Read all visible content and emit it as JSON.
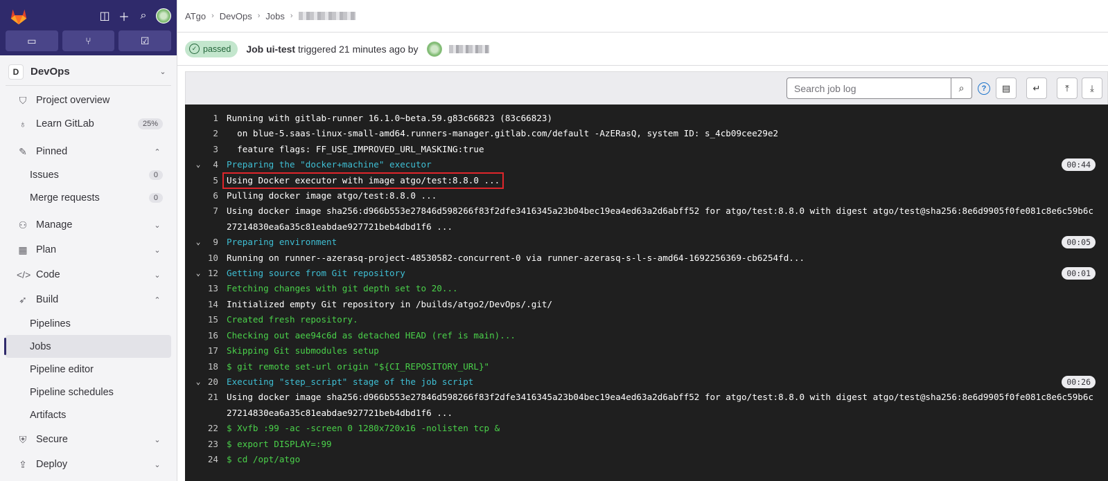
{
  "sidebar": {
    "project": {
      "avatar": "D",
      "name": "DevOps"
    },
    "items": [
      {
        "key": "overview",
        "label": "Project overview",
        "icon": "project-icon"
      },
      {
        "key": "learn",
        "label": "Learn GitLab",
        "icon": "bulb-icon",
        "badge": "25%"
      }
    ],
    "pinned": {
      "label": "Pinned",
      "items": [
        {
          "label": "Issues",
          "count": "0"
        },
        {
          "label": "Merge requests",
          "count": "0"
        }
      ]
    },
    "groups": [
      {
        "label": "Manage"
      },
      {
        "label": "Plan"
      },
      {
        "label": "Code"
      }
    ],
    "build": {
      "label": "Build",
      "items": [
        "Pipelines",
        "Jobs",
        "Pipeline editor",
        "Pipeline schedules",
        "Artifacts"
      ]
    },
    "after": [
      {
        "label": "Secure"
      },
      {
        "label": "Deploy"
      }
    ]
  },
  "breadcrumb": [
    "ATgo",
    "DevOps",
    "Jobs"
  ],
  "job": {
    "status": "passed",
    "title": "Job ui-test",
    "meta": "triggered 21 minutes ago by"
  },
  "toolbar": {
    "search_placeholder": "Search job log"
  },
  "log": [
    {
      "n": "1",
      "t": "Running with gitlab-runner 16.1.0~beta.59.g83c66823 (83c66823)",
      "c": ""
    },
    {
      "n": "2",
      "t": "  on blue-5.saas-linux-small-amd64.runners-manager.gitlab.com/default -AzERasQ, system ID: s_4cb09cee29e2",
      "c": ""
    },
    {
      "n": "3",
      "t": "  feature flags: FF_USE_IMPROVED_URL_MASKING:true",
      "c": ""
    },
    {
      "n": "4",
      "t": "Preparing the \"docker+machine\" executor",
      "c": "cyan",
      "fold": true,
      "dur": "00:44"
    },
    {
      "n": "5",
      "t": "Using Docker executor with image atgo/test:8.8.0 ...",
      "c": "",
      "hl": true
    },
    {
      "n": "6",
      "t": "Pulling docker image atgo/test:8.8.0 ...",
      "c": ""
    },
    {
      "n": "7",
      "t": "Using docker image sha256:d966b553e27846d598266f83f2dfe3416345a23b04bec19ea4ed63a2d6abff52 for atgo/test:8.8.0 with digest atgo/test@sha256:8e6d9905f0fe081c8e6c59b6c27214830ea6a35c81eabdae927721beb4dbd1f6 ...",
      "c": ""
    },
    {
      "n": "9",
      "t": "Preparing environment",
      "c": "cyan",
      "fold": true,
      "dur": "00:05"
    },
    {
      "n": "10",
      "t": "Running on runner--azerasq-project-48530582-concurrent-0 via runner-azerasq-s-l-s-amd64-1692256369-cb6254fd...",
      "c": ""
    },
    {
      "n": "12",
      "t": "Getting source from Git repository",
      "c": "cyan",
      "fold": true,
      "dur": "00:01"
    },
    {
      "n": "13",
      "t": "Fetching changes with git depth set to 20...",
      "c": "green"
    },
    {
      "n": "14",
      "t": "Initialized empty Git repository in /builds/atgo2/DevOps/.git/",
      "c": ""
    },
    {
      "n": "15",
      "t": "Created fresh repository.",
      "c": "green"
    },
    {
      "n": "16",
      "t": "Checking out aee94c6d as detached HEAD (ref is main)...",
      "c": "green"
    },
    {
      "n": "17",
      "t": "Skipping Git submodules setup",
      "c": "green"
    },
    {
      "n": "18",
      "t": "$ git remote set-url origin \"${CI_REPOSITORY_URL}\"",
      "c": "green"
    },
    {
      "n": "20",
      "t": "Executing \"step_script\" stage of the job script",
      "c": "cyan",
      "fold": true,
      "dur": "00:26"
    },
    {
      "n": "21",
      "t": "Using docker image sha256:d966b553e27846d598266f83f2dfe3416345a23b04bec19ea4ed63a2d6abff52 for atgo/test:8.8.0 with digest atgo/test@sha256:8e6d9905f0fe081c8e6c59b6c27214830ea6a35c81eabdae927721beb4dbd1f6 ...",
      "c": ""
    },
    {
      "n": "22",
      "t": "$ Xvfb :99 -ac -screen 0 1280x720x16 -nolisten tcp &",
      "c": "green"
    },
    {
      "n": "23",
      "t": "$ export DISPLAY=:99",
      "c": "green"
    },
    {
      "n": "24",
      "t": "$ cd /opt/atgo",
      "c": "green"
    }
  ]
}
